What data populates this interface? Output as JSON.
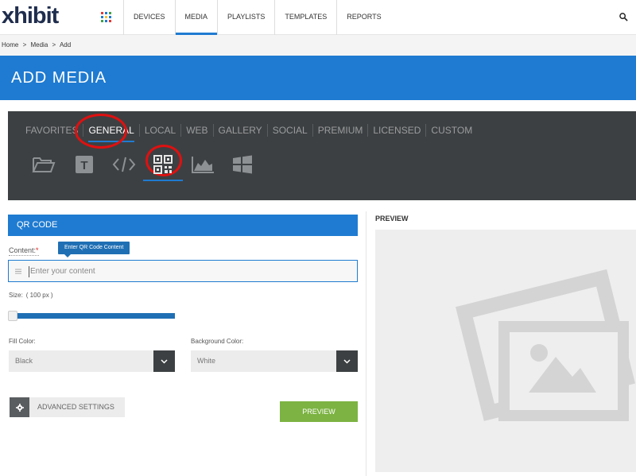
{
  "app": {
    "logo": "xhibit"
  },
  "nav": {
    "items": [
      {
        "label": "DEVICES",
        "active": false
      },
      {
        "label": "MEDIA",
        "active": true
      },
      {
        "label": "PLAYLISTS",
        "active": false
      },
      {
        "label": "TEMPLATES",
        "active": false
      },
      {
        "label": "REPORTS",
        "active": false
      }
    ],
    "apps_icon": "grid-icon",
    "search_icon": "search-icon"
  },
  "breadcrumb": {
    "items": [
      "Home",
      ">",
      "Media",
      ">",
      "Add"
    ]
  },
  "page": {
    "title": "ADD MEDIA"
  },
  "categories": {
    "tabs": [
      {
        "label": "FAVORITES",
        "active": false
      },
      {
        "label": "GENERAL",
        "active": true
      },
      {
        "label": "LOCAL",
        "active": false
      },
      {
        "label": "WEB",
        "active": false
      },
      {
        "label": "GALLERY",
        "active": false
      },
      {
        "label": "SOCIAL",
        "active": false
      },
      {
        "label": "PREMIUM",
        "active": false
      },
      {
        "label": "LICENSED",
        "active": false
      },
      {
        "label": "CUSTOM",
        "active": false
      }
    ],
    "media_types": [
      "folder-icon",
      "text-icon",
      "code-icon",
      "qr-code-icon",
      "chart-icon",
      "windows-icon"
    ],
    "active_media_type": "qr-code-icon"
  },
  "form": {
    "section_title": "QR CODE",
    "content_label": "Content:",
    "required_mark": "*",
    "tooltip": "Enter QR Code Content",
    "content_placeholder": "Enter your content",
    "content_value": "",
    "size_label": "Size:",
    "size_value": "( 100 px )",
    "size_slider_fraction": 0.0,
    "fill_color_label": "Fill Color:",
    "fill_color_value": "Black",
    "background_color_label": "Background Color:",
    "background_color_value": "White",
    "advanced_settings_label": "ADVANCED SETTINGS",
    "preview_button_label": "PREVIEW"
  },
  "preview": {
    "title": "PREVIEW"
  },
  "colors": {
    "accent": "#1f7bd1",
    "panel_dark": "#3d4042",
    "preview_green": "#7cb342",
    "annotation_red": "#e01010"
  }
}
